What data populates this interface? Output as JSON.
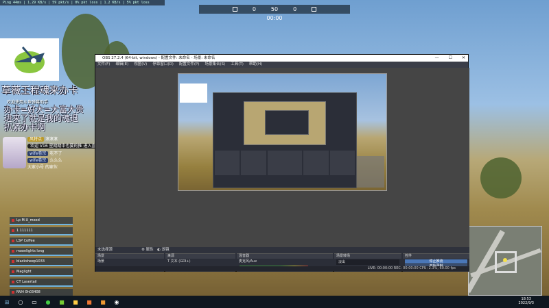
{
  "hud": {
    "topbar": "Ping 44ms  |  1.29 KB/s  |  59 pkt/s  |  0% pkt loss  |  1.2 KB/s  |  5% pkt loss",
    "score_left": "0",
    "score_mid": "50",
    "score_right": "0",
    "timer": "00:00"
  },
  "overlay": {
    "title": "草薇王程魂来办卡",
    "welcome": "欢迎使用斗鱼弹幕助手",
    "lines": [
      "办卡=好大=大富大贵",
      "进来了就是我的魂退",
      "扒紧办卡啊"
    ],
    "chat": [
      {
        "user": "风特点",
        "text": "滚滚滚"
      },
      {
        "user": "",
        "text": "欢迎 V16 星期期中也要的推 进入直播间"
      },
      {
        "user": "wife卷宗",
        "text": "吃不了"
      },
      {
        "user": "wife卷宗",
        "text": "么么么"
      },
      {
        "user": "",
        "text": "大家小号 的家伙"
      }
    ]
  },
  "leaderboard": [
    "Lp M.U_mood",
    "1 111111",
    "LSP Coffee",
    "moonlights long",
    "blacksheep1033",
    "Maglight",
    "CT Lasertail",
    "NVH 0h03408"
  ],
  "obs": {
    "title": "OBS 27.2.4 (64-bit, windows) - 配置文件: 未命名 - 场景: 未命名",
    "menu": [
      "文件(F)",
      "编辑(E)",
      "视图(V)",
      "停靠窗口(D)",
      "配置文件(P)",
      "场景集合(S)",
      "工具(T)",
      "帮助(H)"
    ],
    "win_min": "—",
    "win_max": "☐",
    "win_close": "✕",
    "statusbar": {
      "source": "未选择源",
      "props": "属性",
      "filters": "滤镜"
    },
    "scenes": {
      "header": "场景",
      "items": [
        "场景"
      ]
    },
    "sources": {
      "header": "来源",
      "items": [
        "文本 (GDI+)",
        "图片背景",
        "背景",
        "弹幕",
        "弹幕框",
        "排名",
        "贵宾",
        "窗口捕获"
      ]
    },
    "mixer": {
      "header": "混音器",
      "tracks": [
        {
          "name": "麦克风/Aux"
        },
        {
          "name": "桌面音频"
        }
      ]
    },
    "transitions": {
      "header": "场景转场",
      "type": "淡出",
      "duration_label": "时长",
      "duration": "300 ms"
    },
    "controls": {
      "header": "控件",
      "buttons": [
        "停止推流",
        "开始录制",
        "启动虚拟摄像机",
        "工作室模式",
        "设置",
        "退出"
      ]
    },
    "status": "LIVE: 00:00:00  REC: 00:00:00  CPU: 2.3%, 60.00 fps"
  },
  "taskbar": {
    "time": "18:53",
    "date": "2022/9/3"
  }
}
